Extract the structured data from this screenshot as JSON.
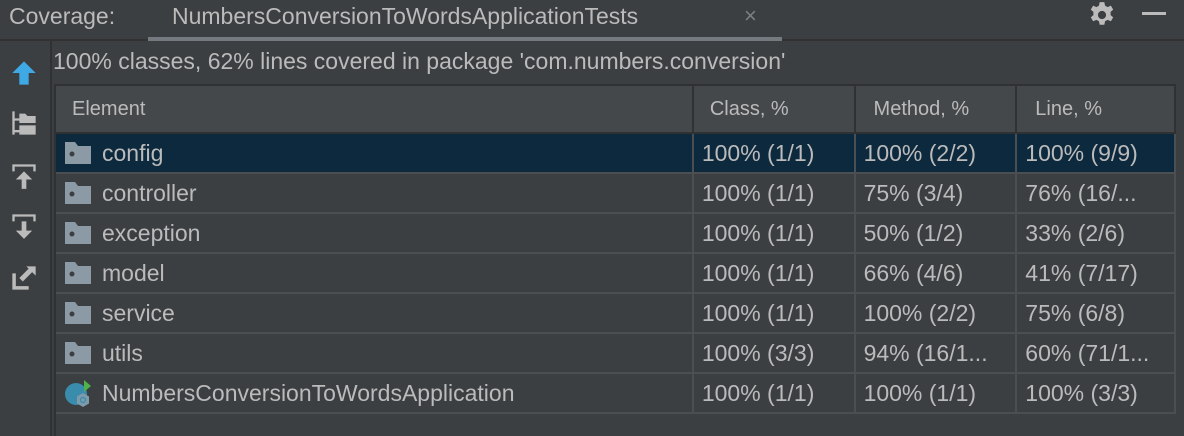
{
  "toolwindow": {
    "label": "Coverage:",
    "tab_title": "NumbersConversionToWordsApplicationTests",
    "close_glyph": "×"
  },
  "summary": "100% classes, 62% lines covered in package 'com.numbers.conversion'",
  "toolbar_icons": [
    "arrow-up-icon",
    "flatten-packages-icon",
    "import-icon",
    "export-icon",
    "open-external-icon"
  ],
  "table": {
    "columns": [
      "Element",
      "Class, %",
      "Method, %",
      "Line, %"
    ],
    "rows": [
      {
        "name": "config",
        "icon": "package-icon",
        "class": "100% (1/1)",
        "method": "100% (2/2)",
        "line": "100% (9/9)",
        "selected": true
      },
      {
        "name": "controller",
        "icon": "package-icon",
        "class": "100% (1/1)",
        "method": "75% (3/4)",
        "line": "76% (16/..."
      },
      {
        "name": "exception",
        "icon": "package-icon",
        "class": "100% (1/1)",
        "method": "50% (1/2)",
        "line": "33% (2/6)"
      },
      {
        "name": "model",
        "icon": "package-icon",
        "class": "100% (1/1)",
        "method": "66% (4/6)",
        "line": "41% (7/17)"
      },
      {
        "name": "service",
        "icon": "package-icon",
        "class": "100% (1/1)",
        "method": "100% (2/2)",
        "line": "75% (6/8)"
      },
      {
        "name": "utils",
        "icon": "package-icon",
        "class": "100% (3/3)",
        "method": "94% (16/1...",
        "line": "60% (71/1..."
      },
      {
        "name": "NumbersConversionToWordsApplication",
        "icon": "spring-boot-class-icon",
        "class": "100% (1/1)",
        "method": "100% (1/1)",
        "line": "100% (3/3)"
      }
    ]
  },
  "colors": {
    "background": "#3c3f41",
    "selection": "#0d293e",
    "text": "#bbbbbb",
    "accent": "#3fa9e6"
  }
}
